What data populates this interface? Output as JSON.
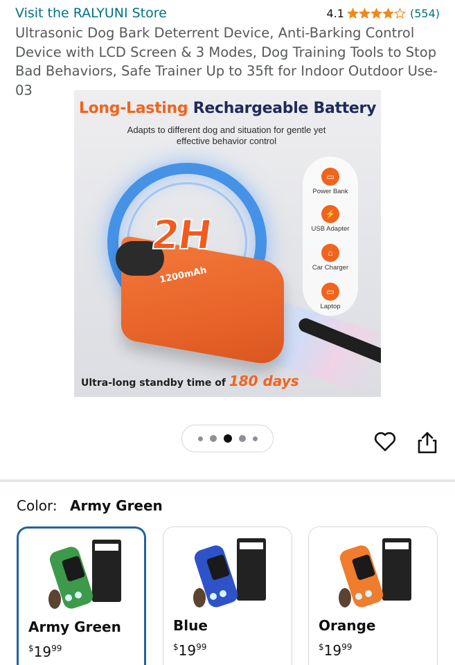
{
  "store": {
    "link": "Visit the RALYUNI Store",
    "rating": "4.1",
    "stars": 4,
    "count": "(554)"
  },
  "product": {
    "title": "Ultrasonic Dog Bark Deterrent Device, Anti-Barking Control Device with LCD Screen & 3 Modes, Dog Training Tools to Stop Bad Behaviors, Safe Trainer Up to 35ft for Indoor Outdoor Use-03"
  },
  "hero": {
    "headline_a": "Long-Lasting",
    "headline_b": "Rechargeable Battery",
    "subline": "Adapts to different dog and situation for gentle yet effective behavior control",
    "big": "2H",
    "capacity": "1200mAh",
    "charge_options": [
      "Power Bank",
      "USB Adapter",
      "Car Charger",
      "Laptop"
    ],
    "bottom_text": "Ultra-long standby time of",
    "bottom_days": "180 days"
  },
  "carousel": {
    "active_index": 2,
    "count": 5
  },
  "colors": {
    "accent": "#2162a1",
    "link": "#007185",
    "orange": "#f0641e"
  },
  "color_select": {
    "label": "Color:",
    "selected": "Army Green",
    "options": [
      {
        "name": "Army Green",
        "price_symbol": "$",
        "price_whole": "19",
        "price_cents": "99",
        "device_color": "#3d9a4a"
      },
      {
        "name": "Blue",
        "price_symbol": "$",
        "price_whole": "19",
        "price_cents": "99",
        "device_color": "#2f52c9"
      },
      {
        "name": "Orange",
        "price_symbol": "$",
        "price_whole": "19",
        "price_cents": "99",
        "device_color": "#ef7d2d"
      }
    ]
  }
}
